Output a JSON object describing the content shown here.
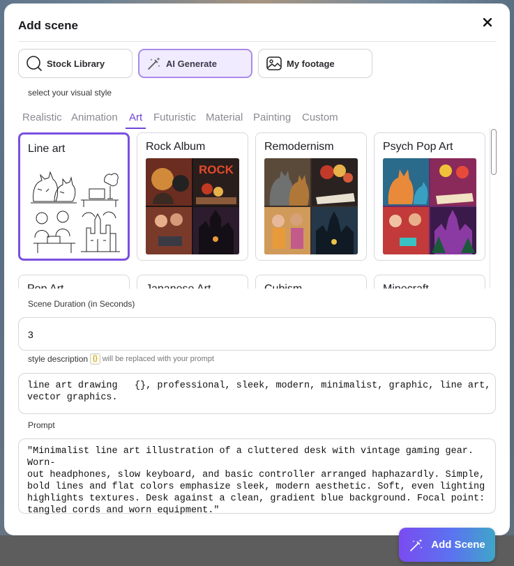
{
  "modal": {
    "title": "Add scene",
    "close_icon": "close-icon"
  },
  "sources": [
    {
      "label": "Stock Library",
      "icon": "search-icon",
      "active": false
    },
    {
      "label": "AI Generate",
      "icon": "magic-wand-icon",
      "active": true
    },
    {
      "label": "My footage",
      "icon": "image-icon",
      "active": false
    }
  ],
  "style_caption": "select your visual style",
  "tabs": [
    "Realistic",
    "Animation",
    "Art",
    "Futuristic",
    "Material",
    "Painting",
    "Custom"
  ],
  "active_tab": "Art",
  "styles": [
    {
      "label": "Line art",
      "selected": true
    },
    {
      "label": "Rock Album",
      "selected": false
    },
    {
      "label": "Remodernism",
      "selected": false
    },
    {
      "label": "Psych Pop Art",
      "selected": false
    },
    {
      "label": "Pop Art",
      "selected": false
    },
    {
      "label": "Japanese Art",
      "selected": false
    },
    {
      "label": "Cubism",
      "selected": false
    },
    {
      "label": "Minecraft",
      "selected": false
    }
  ],
  "thumb_texts": {
    "rock_word": "ROCK"
  },
  "duration": {
    "label": "Scene Duration (in Seconds)",
    "value": "3"
  },
  "style_description": {
    "label": "style description",
    "chip": "{}",
    "hint": "will be replaced with your prompt",
    "value": "line art drawing   {}, professional, sleek, modern, minimalist, graphic, line art,\nvector graphics."
  },
  "prompt": {
    "label": "Prompt",
    "value": "\"Minimalist line art illustration of a cluttered desk with vintage gaming gear. Worn-\nout headphones, slow keyboard, and basic controller arranged haphazardly. Simple,\nbold lines and flat colors emphasize sleek, modern aesthetic. Soft, even lighting\nhighlights textures. Desk against a clean, gradient blue background. Focal point:\ntangled cords and worn equipment.\""
  },
  "add_scene": {
    "label": "Add Scene",
    "icon": "magic-wand-icon"
  },
  "colors": {
    "accent": "#6f45d8",
    "selected_border": "#7a4fe0",
    "button_gradient_start": "#7b4bf0",
    "button_gradient_end": "#3fa6c8"
  }
}
